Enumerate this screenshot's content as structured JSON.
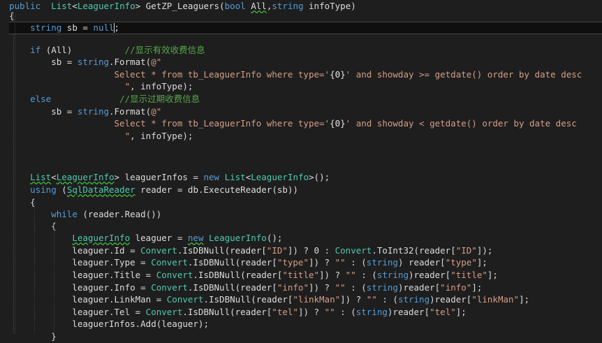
{
  "editor": {
    "lines": [
      [
        {
          "t": "public",
          "c": "kw"
        },
        {
          "t": "  "
        },
        {
          "t": "List",
          "c": "ty"
        },
        {
          "t": "<"
        },
        {
          "t": "LeaguerInfo",
          "c": "ty"
        },
        {
          "t": "> GetZP_Leaguers("
        },
        {
          "t": "bool",
          "c": "kw"
        },
        {
          "t": " "
        },
        {
          "t": "All",
          "c": "sq"
        },
        {
          "t": ","
        },
        {
          "t": "string",
          "c": "kw"
        },
        {
          "t": " infoType)"
        }
      ],
      [
        {
          "t": "{"
        }
      ],
      [
        {
          "t": "    "
        },
        {
          "t": "string",
          "c": "kw"
        },
        {
          "t": " sb = "
        },
        {
          "t": "null",
          "c": "kw"
        },
        {
          "t": ";"
        }
      ],
      [],
      [
        {
          "t": "    "
        },
        {
          "t": "if",
          "c": "kw"
        },
        {
          "t": " (All)          "
        },
        {
          "t": "//显示有效收费信息",
          "c": "cm"
        }
      ],
      [
        {
          "t": "        sb = "
        },
        {
          "t": "string",
          "c": "kw"
        },
        {
          "t": ".Format("
        },
        {
          "t": "@\"",
          "c": "st"
        }
      ],
      [
        {
          "t": "                    Select * from tb_LeaguerInfo where type='",
          "c": "st"
        },
        {
          "t": "{0}",
          "c": "fmt"
        },
        {
          "t": "' and showday >= getdate() order by date desc",
          "c": "st"
        }
      ],
      [
        {
          "t": "                      \"",
          "c": "st"
        },
        {
          "t": ", infoType);"
        }
      ],
      [
        {
          "t": "    "
        },
        {
          "t": "else",
          "c": "kw"
        },
        {
          "t": "             "
        },
        {
          "t": "//显示过期收费信息",
          "c": "cm"
        }
      ],
      [
        {
          "t": "        sb = "
        },
        {
          "t": "string",
          "c": "kw"
        },
        {
          "t": ".Format("
        },
        {
          "t": "@\"",
          "c": "st"
        }
      ],
      [
        {
          "t": "                    Select * from tb_LeaguerInfo where type='",
          "c": "st"
        },
        {
          "t": "{0}",
          "c": "fmt"
        },
        {
          "t": "' and showday < getdate() order by date desc",
          "c": "st"
        }
      ],
      [
        {
          "t": "                      \"",
          "c": "st"
        },
        {
          "t": ", infoType);"
        }
      ],
      [],
      [],
      [
        {
          "t": "    "
        },
        {
          "t": "List",
          "c": "ty sq"
        },
        {
          "t": "<"
        },
        {
          "t": "LeaguerInfo",
          "c": "ty sq"
        },
        {
          "t": "> leaguerInfos = "
        },
        {
          "t": "new",
          "c": "kw"
        },
        {
          "t": " "
        },
        {
          "t": "List",
          "c": "ty"
        },
        {
          "t": "<"
        },
        {
          "t": "LeaguerInfo",
          "c": "ty"
        },
        {
          "t": ">();"
        }
      ],
      [
        {
          "t": "    "
        },
        {
          "t": "using",
          "c": "kw"
        },
        {
          "t": " ("
        },
        {
          "t": "SqlDataReader",
          "c": "ty sq"
        },
        {
          "t": " reader = db.ExecuteReader(sb))"
        }
      ],
      [
        {
          "t": "    {"
        }
      ],
      [
        {
          "t": "        "
        },
        {
          "t": "while",
          "c": "kw"
        },
        {
          "t": " (reader.Read())"
        }
      ],
      [
        {
          "t": "        {"
        }
      ],
      [
        {
          "t": "            "
        },
        {
          "t": "LeaguerInfo",
          "c": "ty sq"
        },
        {
          "t": " leaguer = "
        },
        {
          "t": "new",
          "c": "kw sq"
        },
        {
          "t": " "
        },
        {
          "t": "LeaguerInfo",
          "c": "ty"
        },
        {
          "t": "();"
        }
      ],
      [
        {
          "t": "            leaguer.Id = "
        },
        {
          "t": "Convert",
          "c": "ty"
        },
        {
          "t": ".IsDBNull(reader["
        },
        {
          "t": "\"ID\"",
          "c": "st"
        },
        {
          "t": "]) ? 0 : "
        },
        {
          "t": "Convert",
          "c": "ty"
        },
        {
          "t": ".ToInt32(reader["
        },
        {
          "t": "\"ID\"",
          "c": "st"
        },
        {
          "t": "]);"
        }
      ],
      [
        {
          "t": "            leaguer.Type = "
        },
        {
          "t": "Convert",
          "c": "ty"
        },
        {
          "t": ".IsDBNull(reader["
        },
        {
          "t": "\"type\"",
          "c": "st"
        },
        {
          "t": "]) ? "
        },
        {
          "t": "\"\"",
          "c": "st"
        },
        {
          "t": " : ("
        },
        {
          "t": "string",
          "c": "kw"
        },
        {
          "t": ") reader["
        },
        {
          "t": "\"type\"",
          "c": "st"
        },
        {
          "t": "];"
        }
      ],
      [
        {
          "t": "            leaguer.Title = "
        },
        {
          "t": "Convert",
          "c": "ty"
        },
        {
          "t": ".IsDBNull(reader["
        },
        {
          "t": "\"title\"",
          "c": "st"
        },
        {
          "t": "]) ? "
        },
        {
          "t": "\"\"",
          "c": "st"
        },
        {
          "t": " : ("
        },
        {
          "t": "string",
          "c": "kw"
        },
        {
          "t": ")reader["
        },
        {
          "t": "\"title\"",
          "c": "st"
        },
        {
          "t": "];"
        }
      ],
      [
        {
          "t": "            leaguer.Info = "
        },
        {
          "t": "Convert",
          "c": "ty"
        },
        {
          "t": ".IsDBNull(reader["
        },
        {
          "t": "\"info\"",
          "c": "st"
        },
        {
          "t": "]) ? "
        },
        {
          "t": "\"\"",
          "c": "st"
        },
        {
          "t": " : ("
        },
        {
          "t": "string",
          "c": "kw"
        },
        {
          "t": ")reader["
        },
        {
          "t": "\"info\"",
          "c": "st"
        },
        {
          "t": "];"
        }
      ],
      [
        {
          "t": "            leaguer.LinkMan = "
        },
        {
          "t": "Convert",
          "c": "ty"
        },
        {
          "t": ".IsDBNull(reader["
        },
        {
          "t": "\"linkMan\"",
          "c": "st"
        },
        {
          "t": "]) ? "
        },
        {
          "t": "\"\"",
          "c": "st"
        },
        {
          "t": " : ("
        },
        {
          "t": "string",
          "c": "kw"
        },
        {
          "t": ")reader["
        },
        {
          "t": "\"linkMan\"",
          "c": "st"
        },
        {
          "t": "];"
        }
      ],
      [
        {
          "t": "            leaguer.Tel = "
        },
        {
          "t": "Convert",
          "c": "ty"
        },
        {
          "t": ".IsDBNull(reader["
        },
        {
          "t": "\"tel\"",
          "c": "st"
        },
        {
          "t": "]) ? "
        },
        {
          "t": "\"\"",
          "c": "st"
        },
        {
          "t": " : ("
        },
        {
          "t": "string",
          "c": "kw"
        },
        {
          "t": ")reader["
        },
        {
          "t": "\"tel\"",
          "c": "st"
        },
        {
          "t": "];"
        }
      ],
      [
        {
          "t": "            leaguerInfos.Add(leaguer);"
        }
      ],
      [
        {
          "t": "        }"
        }
      ]
    ]
  }
}
